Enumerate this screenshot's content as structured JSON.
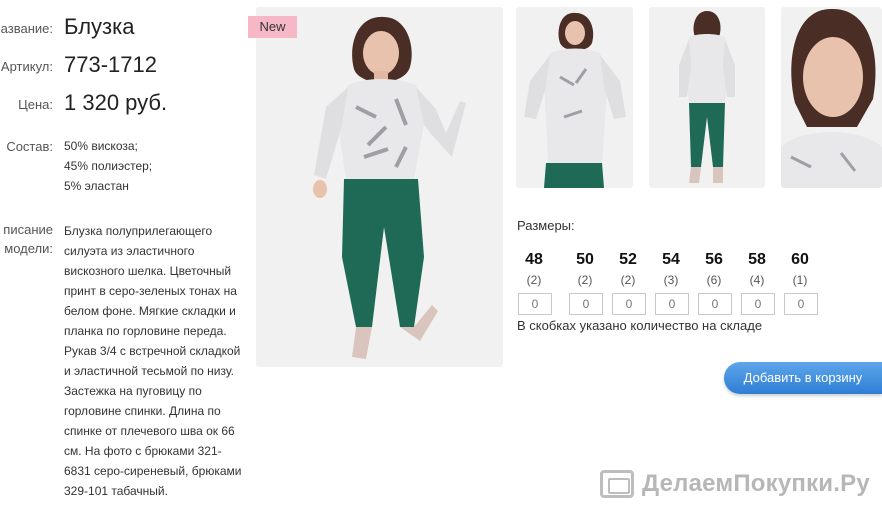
{
  "product": {
    "name_label": "азвание:",
    "name": "Блузка",
    "article_label": "Артикул:",
    "article": "773-1712",
    "price_label": "Цена:",
    "price": "1 320 руб.",
    "composition_label": "Состав:",
    "composition": [
      "50% вискоза;",
      "45% полиэстер;",
      "5% эластан"
    ],
    "description_label_1": "писание",
    "description_label_2": "модели:",
    "description": "Блузка полуприлегающего силуэта из эластичного вискозного шелка. Цветочный принт в серо-зеленых тонах на белом фоне. Мягкие складки и планка по горловине переда. Рукав 3/4 с встречной складкой и эластичной тесьмой по низу. Застежка на пуговицу по горловине спинки. Длина по спинке от плечевого шва ок 66 см. На фото с брюками 321-6831 серо-сиреневый, брюками 329-101 табачный."
  },
  "badge": "New",
  "sizes_title": "Размеры:",
  "sizes": [
    {
      "size": "48",
      "count": "(2)",
      "qty": "0"
    },
    {
      "size": "50",
      "count": "(2)",
      "qty": "0"
    },
    {
      "size": "52",
      "count": "(2)",
      "qty": "0"
    },
    {
      "size": "54",
      "count": "(3)",
      "qty": "0"
    },
    {
      "size": "56",
      "count": "(6)",
      "qty": "0"
    },
    {
      "size": "58",
      "count": "(4)",
      "qty": "0"
    },
    {
      "size": "60",
      "count": "(1)",
      "qty": "0"
    }
  ],
  "stock_note": "В скобках указано количество на складе",
  "cart_button": "Добавить в корзину",
  "logo_text": "ДелаемПокупки.Ру",
  "colors": {
    "trousers": "#1f6a56",
    "blouse": "#e8e8ea",
    "button": "#3b88dc",
    "badge": "#f6b7c7"
  }
}
